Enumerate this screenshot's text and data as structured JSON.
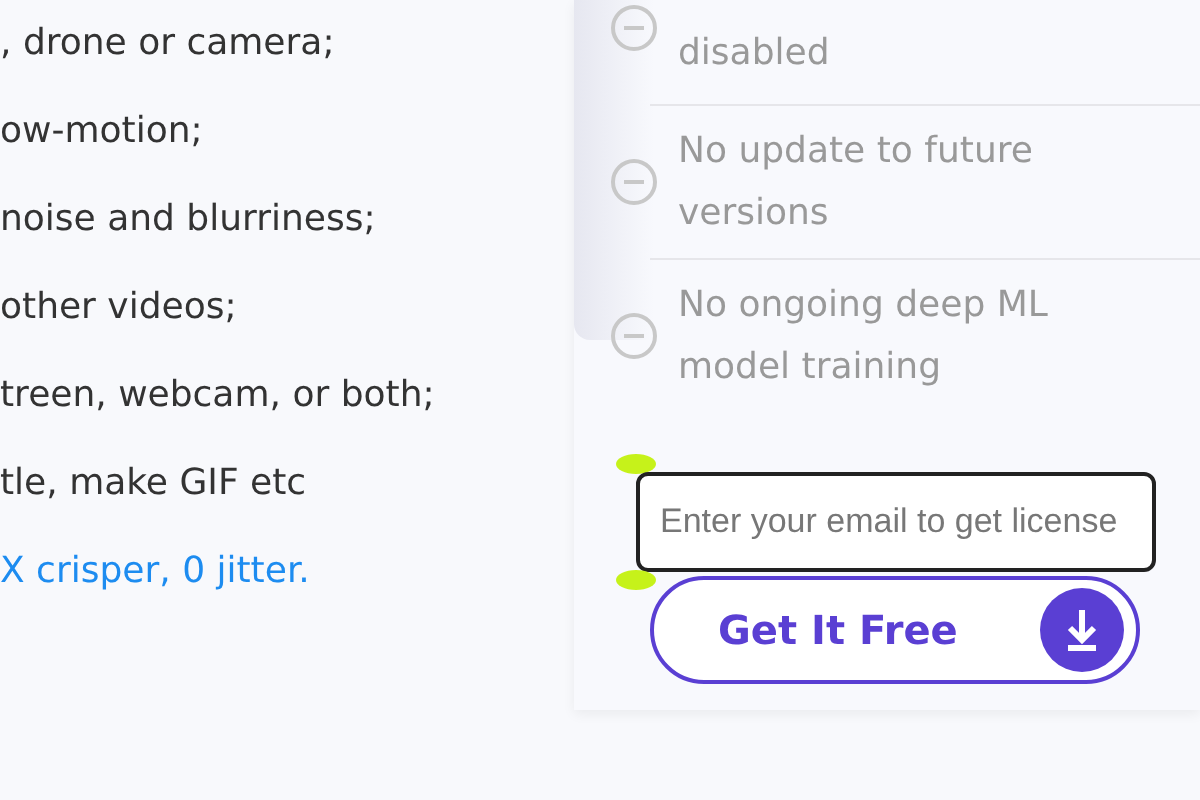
{
  "features": [
    {
      "text": ", drone or camera;",
      "kind": "plain"
    },
    {
      "text": "ow-motion;",
      "kind": "plain"
    },
    {
      "text": "noise and blurriness;",
      "kind": "plain"
    },
    {
      "text": "other videos;",
      "kind": "plain"
    },
    {
      "text": "treen, webcam, or both;",
      "kind": "plain"
    },
    {
      "text": "tle, make GIF etc",
      "kind": "plain"
    },
    {
      "text": "X crisper, 0 jitter.",
      "kind": "link"
    }
  ],
  "limitations": [
    {
      "lines": [
        "disabled"
      ]
    },
    {
      "lines": [
        "No update to future",
        "versions"
      ]
    },
    {
      "lines": [
        "No ongoing deep ML",
        "model training"
      ]
    }
  ],
  "email": {
    "placeholder": "Enter your email to get license"
  },
  "button": {
    "label": "Get It Free"
  }
}
